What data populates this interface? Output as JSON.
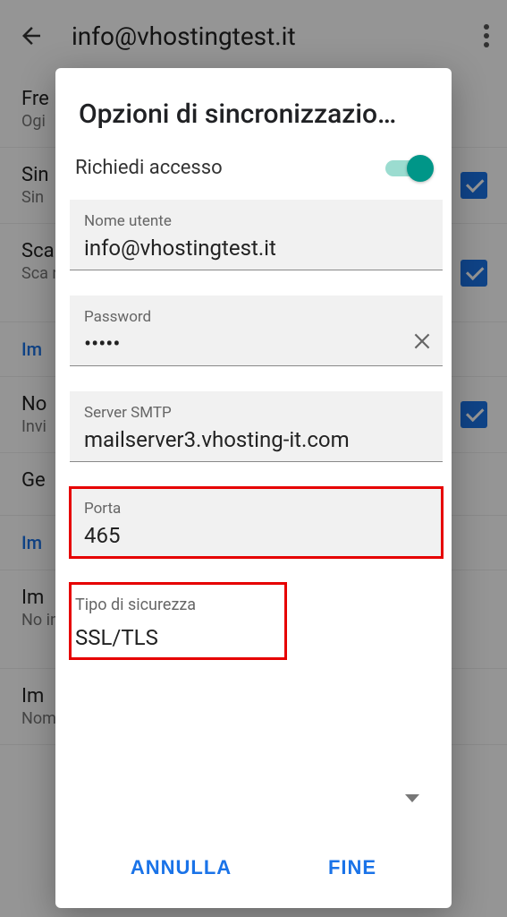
{
  "background": {
    "header_title": "info@vhostingtest.it",
    "rows": [
      {
        "title": "Fre",
        "subtitle": "Ogi"
      },
      {
        "title": "Sin",
        "subtitle": "Sin",
        "check": true
      },
      {
        "title": "Sca",
        "subtitle": "Sca rec",
        "check": true
      },
      {
        "title": "Im",
        "section": true
      },
      {
        "title": "No",
        "subtitle": "Invi",
        "check": true
      },
      {
        "title": "Ge",
        "subtitle": ""
      },
      {
        "title": "Im",
        "section": true
      },
      {
        "title": "Im",
        "subtitle": "No in e"
      },
      {
        "title": "Im",
        "subtitle": "Nome utente, password e altre impostazioni server in uscita"
      }
    ]
  },
  "dialog": {
    "title": "Opzioni di sincronizzazio…",
    "require_login_label": "Richiedi accesso",
    "require_login_on": true,
    "fields": {
      "username": {
        "label": "Nome utente",
        "value": "info@vhostingtest.it"
      },
      "password": {
        "label": "Password",
        "value": "•••••"
      },
      "server": {
        "label": "Server SMTP",
        "value": "mailserver3.vhosting-it.com"
      },
      "port": {
        "label": "Porta",
        "value": "465"
      },
      "security": {
        "label": "Tipo di sicurezza",
        "value": "SSL/TLS"
      }
    },
    "actions": {
      "cancel": "ANNULLA",
      "done": "FINE"
    }
  }
}
